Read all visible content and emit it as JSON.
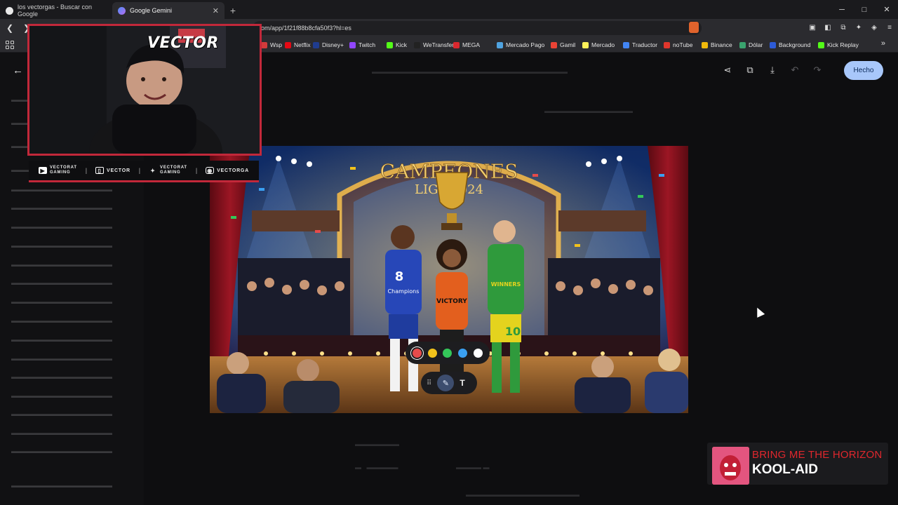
{
  "browser": {
    "tabs": [
      {
        "title": "los vectorgas - Buscar con Google",
        "active": false
      },
      {
        "title": "Google Gemini",
        "active": true
      }
    ],
    "url": "om/app/1f21f88b8cfa50f3?hl=es",
    "window_controls": [
      "─",
      "□",
      "✕"
    ]
  },
  "bookmarks": [
    {
      "label": "Wsp",
      "color": "#d23b3b"
    },
    {
      "label": "Netflix",
      "color": "#e50914"
    },
    {
      "label": "Disney+",
      "color": "#1f3c8f"
    },
    {
      "label": "Twitch",
      "color": "#9146ff"
    },
    {
      "label": "Kick",
      "color": "#53fc18"
    },
    {
      "label": "WeTransfer",
      "color": "#222222"
    },
    {
      "label": "MEGA",
      "color": "#d9272e"
    },
    {
      "label": "Mercado Pago",
      "color": "#4fa3e0"
    },
    {
      "label": "Gamil",
      "color": "#ea4335"
    },
    {
      "label": "Mercado",
      "color": "#fff159"
    },
    {
      "label": "Traductor",
      "color": "#4285f4"
    },
    {
      "label": "noTube",
      "color": "#e0362c"
    },
    {
      "label": "Binance",
      "color": "#f0b90b"
    },
    {
      "label": "Dólar",
      "color": "#3aa36e"
    },
    {
      "label": "Background",
      "color": "#2d5bd7"
    },
    {
      "label": "Kick Replay",
      "color": "#53fc18"
    }
  ],
  "editor": {
    "done_label": "Hecho",
    "tools": [
      "share-icon",
      "copy-icon",
      "download-icon",
      "undo-icon",
      "redo-icon"
    ],
    "colors": [
      "#e64b4b",
      "#f2c21b",
      "#34c759",
      "#3aa0f2",
      "#ffffff"
    ],
    "text_tool_label": "T"
  },
  "artwork": {
    "banner_line1": "CAMPEONES",
    "banner_line2": "LIGA 2024",
    "jersey_blue_number": "8",
    "jersey_blue_text": "Champions",
    "jersey_orange_text": "VICTORY",
    "jersey_green_number": "10",
    "jersey_green_text": "WINNERS"
  },
  "stream": {
    "brand": "VECTOR",
    "socials": [
      {
        "icon": "youtube-icon",
        "line1": "VECTORAT",
        "line2": "GAMING"
      },
      {
        "icon": "twitch-icon",
        "line1": "VECTOR",
        "line2": ""
      },
      {
        "icon": "twitter-icon",
        "line1": "VECTORAT",
        "line2": "GAMING"
      },
      {
        "icon": "instagram-icon",
        "line1": "VECTORGA",
        "line2": ""
      }
    ],
    "separator": "|"
  },
  "now_playing": {
    "artist": "BRING ME THE HORIZON",
    "song": "KOOL-AID"
  }
}
